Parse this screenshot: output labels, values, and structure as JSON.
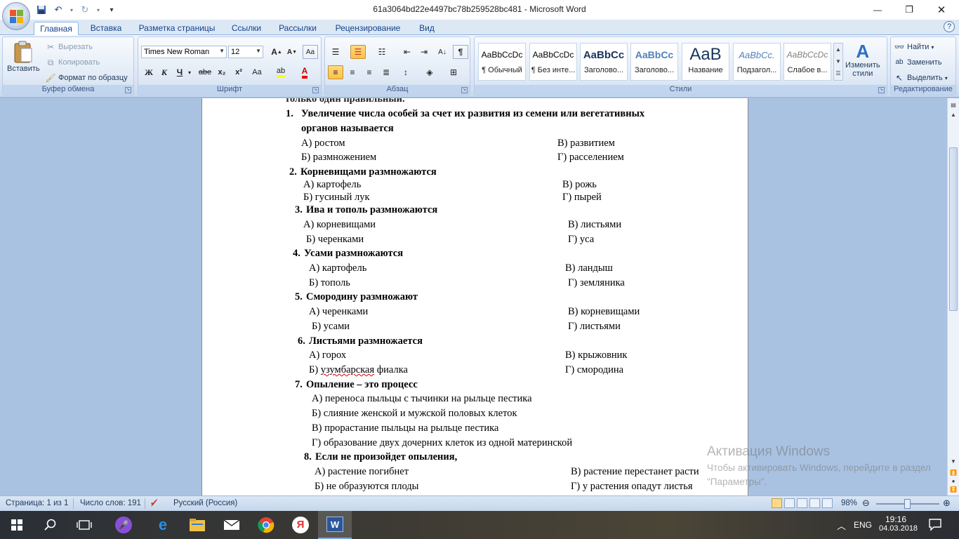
{
  "window": {
    "title": "61a3064bd22e4497bc78b259528bc481 - Microsoft Word",
    "minimize_glyph": "—",
    "restore_glyph": "❐",
    "close_glyph": "✕"
  },
  "qat": {
    "icons": [
      "save-icon",
      "undo-icon",
      "redo-icon",
      "customize-icon"
    ]
  },
  "tabs": [
    "Главная",
    "Вставка",
    "Разметка страницы",
    "Ссылки",
    "Рассылки",
    "Рецензирование",
    "Вид"
  ],
  "ribbon": {
    "clipboard": {
      "label": "Буфер обмена",
      "paste": "Вставить",
      "cut": "Вырезать",
      "copy": "Копировать",
      "format_painter": "Формат по образцу"
    },
    "font": {
      "label": "Шрифт",
      "name": "Times New Roman",
      "size": "12",
      "bold": "Ж",
      "italic": "К",
      "underline": "Ч",
      "strike": "abe",
      "sub": "x₂",
      "sup": "x²",
      "case": "Aa"
    },
    "paragraph": {
      "label": "Абзац"
    },
    "styles": {
      "label": "Стили",
      "items": [
        {
          "sample": "AaBbCcDc",
          "name": "¶ Обычный"
        },
        {
          "sample": "AaBbCcDc",
          "name": "¶ Без инте..."
        },
        {
          "sample": "AaBbCc",
          "name": "Заголово..."
        },
        {
          "sample": "AaBbCc",
          "name": "Заголово..."
        },
        {
          "sample": "AaB",
          "name": "Название"
        },
        {
          "sample": "AaBbCc.",
          "name": "Подзагол..."
        },
        {
          "sample": "AaBbCcDc",
          "name": "Слабое в..."
        }
      ],
      "change_styles_1": "Изменить",
      "change_styles_2": "стили"
    },
    "editing": {
      "label": "Редактирование",
      "find": "Найти",
      "replace": "Заменить",
      "select": "Выделить"
    }
  },
  "document": {
    "partial_top": "только один правильный.",
    "lines": [
      {
        "num": "1.",
        "text": "Увеличение числа особей за счет их развития из семени или вегетативных"
      },
      {
        "text": "органов называется"
      },
      {
        "left": "А) ростом",
        "right": "В) развитием"
      },
      {
        "left": "Б) размножением",
        "right": "Г) расселением"
      },
      {
        "num": "2.",
        "text": "Корневищами размножаются"
      },
      {
        "left": "А) картофель",
        "right": "В) рожь"
      },
      {
        "left": "Б) гусиный лук",
        "right": "Г) пырей"
      },
      {
        "num": "3.",
        "text": "Ива и тополь размножаются"
      },
      {
        "left": "А) корневищами",
        "right": "В) листьями"
      },
      {
        "left": "Б) черенками",
        "right": "Г) уса"
      },
      {
        "num": "4.",
        "text": "Усами размножаются"
      },
      {
        "left": "А) картофель",
        "right": "В) ландыш"
      },
      {
        "left": "Б) тополь",
        "right": "Г) земляника"
      },
      {
        "num": "5.",
        "text": "Смородину размножают"
      },
      {
        "left": "А) черенками",
        "right": "В) корневищами"
      },
      {
        "left": "Б) усами",
        "right": "Г) листьями"
      },
      {
        "num": "6.",
        "text": "Листьями размножается"
      },
      {
        "left": "А) горох",
        "right": "В) крыжовник"
      },
      {
        "left_prefix": "Б) ",
        "left_squiggle": "узумбарская",
        "left_suffix": " фиалка",
        "right": "Г) смородина"
      },
      {
        "num": "7.",
        "text": "Опыление – это процесс"
      },
      {
        "left": "А) переноса пыльцы с тычинки на рыльце пестика"
      },
      {
        "left": "Б) слияние женской и мужской половых клеток"
      },
      {
        "left": "В)  прорастание пыльцы на рыльце пестика"
      },
      {
        "left": "Г) образование двух дочерних клеток из одной материнской"
      },
      {
        "num": "8.",
        "text": "Если не произойдет опыления,"
      },
      {
        "left": "А)  растение погибнет",
        "right": "В) растение перестанет расти"
      },
      {
        "left": "Б) не образуются плоды",
        "right": "Г) у растения опадут листья"
      }
    ]
  },
  "activation": {
    "title": "Активация Windows",
    "subtitle": "Чтобы активировать Windows, перейдите в раздел \"Параметры\"."
  },
  "status": {
    "page": "Страница: 1 из 1",
    "words": "Число слов: 191",
    "language": "Русский (Россия)",
    "zoom": "98%",
    "zoom_level": 0.49
  },
  "taskbar": {
    "apps": [
      "start-icon",
      "search-icon",
      "task-view-icon",
      "cortana-icon",
      "edge-icon",
      "explorer-icon",
      "mail-icon",
      "chrome-icon",
      "yandex-icon",
      "word-icon"
    ],
    "lang": "ENG",
    "time": "19:16",
    "date": "04.03.2018"
  }
}
